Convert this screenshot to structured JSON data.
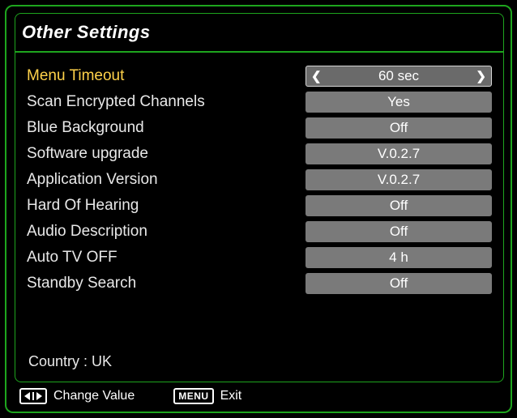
{
  "header": {
    "title": "Other Settings"
  },
  "rows": [
    {
      "label": "Menu Timeout",
      "value": "60 sec",
      "active": true,
      "arrows": true
    },
    {
      "label": "Scan Encrypted Channels",
      "value": "Yes"
    },
    {
      "label": "Blue Background",
      "value": "Off"
    },
    {
      "label": "Software upgrade",
      "value": "V.0.2.7"
    },
    {
      "label": "Application Version",
      "value": "V.0.2.7"
    },
    {
      "label": "Hard Of Hearing",
      "value": "Off"
    },
    {
      "label": "Audio Description",
      "value": "Off"
    },
    {
      "label": "Auto TV OFF",
      "value": "4 h"
    },
    {
      "label": "Standby Search",
      "value": "Off"
    }
  ],
  "country_line": "Country : UK",
  "footer": {
    "change_value": "Change Value",
    "menu_key": "MENU",
    "exit": "Exit"
  }
}
